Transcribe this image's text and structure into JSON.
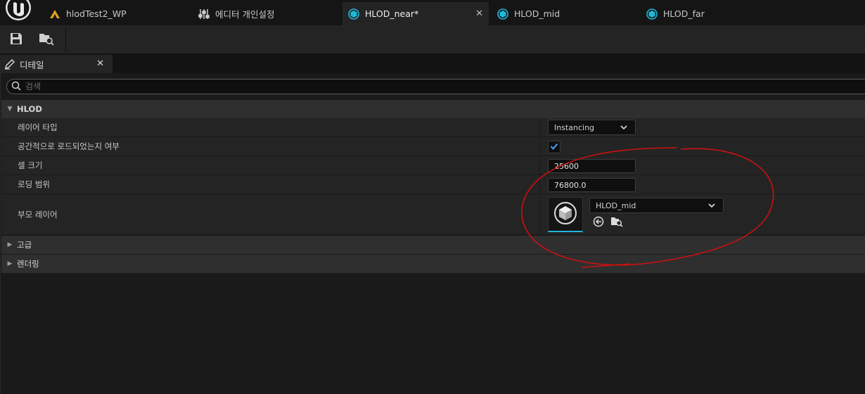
{
  "tabs": [
    {
      "label": "hlodTest2_WP",
      "icon": "level-icon",
      "active": false
    },
    {
      "label": "에디터 개인설정",
      "icon": "sliders-icon",
      "active": false
    },
    {
      "label": "HLOD_near*",
      "icon": "hlod-asset-icon",
      "active": true
    },
    {
      "label": "HLOD_mid",
      "icon": "hlod-asset-icon",
      "active": false
    },
    {
      "label": "HLOD_far",
      "icon": "hlod-asset-icon",
      "active": false
    }
  ],
  "tab_close_glyph": "✕",
  "toolbar": {
    "save_icon": "save-icon",
    "browse_icon": "browse-to-asset-icon"
  },
  "panel": {
    "title": "디테일",
    "close_glyph": "✕"
  },
  "search": {
    "placeholder": "검색"
  },
  "categories": {
    "hlod": {
      "label": "HLOD",
      "expanded": true
    },
    "advanced": {
      "label": "고급",
      "expanded": false
    },
    "rendering": {
      "label": "렌더링",
      "expanded": false
    }
  },
  "properties": {
    "layer_type": {
      "label": "레이어 타입",
      "value": "Instancing"
    },
    "spatially_loaded": {
      "label": "공간적으로 로드되었는지 여부",
      "checked": true
    },
    "cell_size": {
      "label": "셀 크기",
      "value": "25600"
    },
    "loading_range": {
      "label": "로딩 범위",
      "value": "76800.0"
    },
    "parent_layer": {
      "label": "부모 레이어",
      "value": "HLOD_mid"
    }
  },
  "colors": {
    "accent": "#1fb8d8",
    "annotation": "#cc1111",
    "checkmark": "#4aa3ff"
  }
}
